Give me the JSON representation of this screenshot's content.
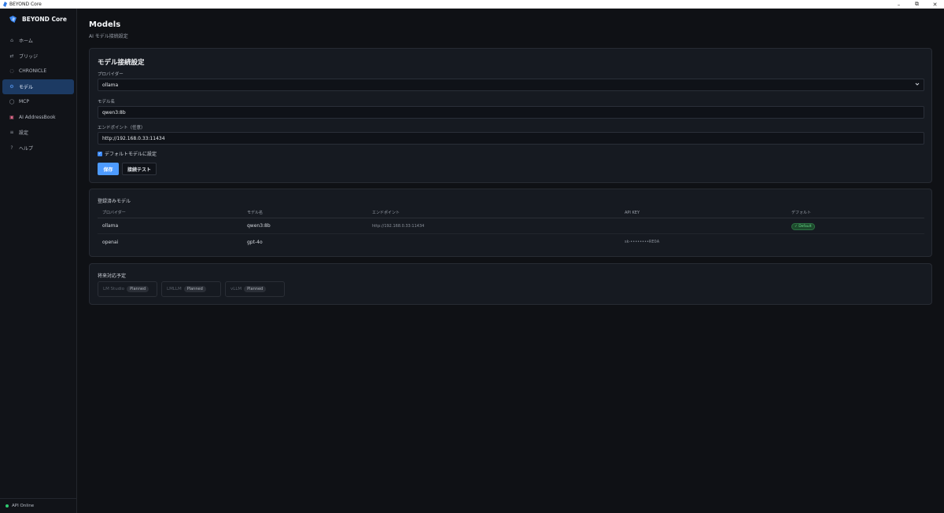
{
  "window": {
    "title": "BEYOND Core",
    "minimize": "–",
    "maximize": "⧉",
    "close": "✕"
  },
  "sidebar": {
    "brand": "BEYOND Core",
    "items": [
      {
        "icon": "⌂",
        "label": "ホーム"
      },
      {
        "icon": "⇄",
        "label": "ブリッジ"
      },
      {
        "icon": "◌",
        "label": "CHRONICLE"
      },
      {
        "icon": "⚙",
        "label": "モデル"
      },
      {
        "icon": "◯",
        "label": "MCP"
      },
      {
        "icon": "▣",
        "label": "AI AddressBook"
      },
      {
        "icon": "≡",
        "label": "設定"
      },
      {
        "icon": "?",
        "label": "ヘルプ"
      }
    ],
    "status": "API Online"
  },
  "page": {
    "title": "Models",
    "subtitle": "AI モデル接続設定"
  },
  "connection": {
    "title": "モデル接続設定",
    "provider_label": "プロバイダー",
    "provider_value": "ollama",
    "model_label": "モデル名",
    "model_value": "qwen3:8b",
    "endpoint_label": "エンドポイント（任意）",
    "endpoint_value": "http://192.168.0.33:11434",
    "default_label": "デフォルトモデルに設定",
    "save": "保存",
    "test": "接続テスト"
  },
  "registered": {
    "title": "登録済みモデル",
    "headers": [
      "プロバイダー",
      "モデル名",
      "エンドポイント",
      "API KEY",
      "デフォルト"
    ],
    "rows": [
      {
        "provider": "ollama",
        "model": "qwen3:8b",
        "endpoint": "http://192.168.0.33:11434",
        "api_key": "",
        "default": "✓ Default"
      },
      {
        "provider": "openai",
        "model": "gpt-4o",
        "endpoint": "",
        "api_key": "sk-••••••••RE0A",
        "default": ""
      }
    ]
  },
  "planned": {
    "title": "将来対応予定",
    "items": [
      {
        "name": "LM Studio",
        "badge": "Planned"
      },
      {
        "name": "LMLLM",
        "badge": "Planned"
      },
      {
        "name": "vLLM",
        "badge": "Planned"
      }
    ]
  },
  "colors": {
    "accent": "#4d9bff",
    "active_nav": "#1c3a63",
    "success": "#2ecc71"
  }
}
